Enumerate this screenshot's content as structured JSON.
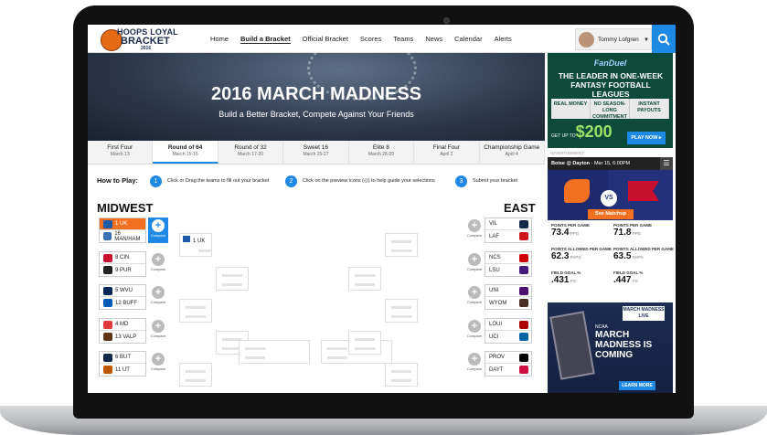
{
  "nav": {
    "logo": {
      "line1": "HOOPS LOYAL",
      "line2": "BRACKET",
      "line3": "2016"
    },
    "links": [
      "Home",
      "Build a Bracket",
      "Official Bracket",
      "Scores",
      "Teams",
      "News",
      "Calendar",
      "Alerts"
    ],
    "active_link": "Build a Bracket",
    "user_name": "Tommy Lofgren"
  },
  "hero": {
    "title": "2016 MARCH MADNESS",
    "subtitle": "Build a Better Bracket, Compete Against Your Friends"
  },
  "rounds": [
    {
      "label": "First Four",
      "date": "March 13"
    },
    {
      "label": "Round of 64",
      "date": "March 15-16",
      "active": true
    },
    {
      "label": "Round of 32",
      "date": "March 17-20"
    },
    {
      "label": "Sweet 16",
      "date": "March 25-27"
    },
    {
      "label": "Elite 8",
      "date": "March 28-29"
    },
    {
      "label": "Final Four",
      "date": "April 2"
    },
    {
      "label": "Championship Game",
      "date": "April 4"
    }
  ],
  "howto": {
    "label": "How to Play:",
    "steps": [
      {
        "num": "1",
        "text": "Click or Drag the teams to fill out your bracket"
      },
      {
        "num": "2",
        "text": "Click on the preview icons (◎) to help guide your selections"
      },
      {
        "num": "3",
        "text": "Submit your bracket"
      }
    ]
  },
  "regions": {
    "left": "MIDWEST",
    "right": "EAST"
  },
  "compare_label": "Compare",
  "left_matchups": [
    {
      "a": "1  UK",
      "b": "16 MAN/HAM",
      "selected": true,
      "ca": "#1e5aa8",
      "cb": "#3b6fb6"
    },
    {
      "a": "8  CIN",
      "b": "9  PUR",
      "ca": "#c8102e",
      "cb": "#222222"
    },
    {
      "a": "5  WVU",
      "b": "12 BUFF",
      "ca": "#002855",
      "cb": "#005bbb"
    },
    {
      "a": "4  MD",
      "b": "13 VALP",
      "ca": "#e03a3e",
      "cb": "#613318"
    },
    {
      "a": "6  BUT",
      "b": "11 UT",
      "ca": "#13294b",
      "cb": "#bf5700"
    }
  ],
  "right_matchups": [
    {
      "a": "VIL",
      "b": "LAF",
      "ca": "#13294b",
      "cb": "#ce181e"
    },
    {
      "a": "NCS",
      "b": "LSU",
      "ca": "#cc0000",
      "cb": "#461d7c"
    },
    {
      "a": "UNI",
      "b": "WYOM",
      "ca": "#4b116f",
      "cb": "#492f24"
    },
    {
      "a": "LOUI",
      "b": "UCI",
      "ca": "#ad0000",
      "cb": "#0064a4"
    },
    {
      "a": "PROV",
      "b": "DAYT",
      "ca": "#000000",
      "cb": "#ce1141"
    }
  ],
  "r32_first": "1  UK",
  "sidebar": {
    "ad1": {
      "brand": "FanDuel",
      "headline": "THE LEADER IN ONE-WEEK FANTASY FOOTBALL LEAGUES",
      "features": [
        "REAL MONEY",
        "NO SEASON-LONG COMMITMENT",
        "INSTANT PAYOUTS"
      ],
      "promo_prefix": "GET UP TO",
      "promo_amount": "$200",
      "promo_suffix": "FREE ON YOUR FIRST DEPOSIT",
      "cta": "PLAY NOW ▸"
    },
    "ad_label": "ADVERTISEMENT",
    "game": {
      "title": "Boise @ Dayton",
      "when": "· Mar 15, 6:00PM"
    },
    "vs": "VS",
    "see_matchup": "See Matchup",
    "stats_left": [
      {
        "k": "POINTS PER GAME",
        "v": "73.4",
        "u": "PPG"
      },
      {
        "k": "POINTS ALLOWED PER GAME",
        "v": "62.3",
        "u": "PAPG"
      },
      {
        "k": "FIELD GOAL %",
        "v": ".431",
        "u": "FG"
      }
    ],
    "stats_right": [
      {
        "k": "POINTS PER GAME",
        "v": "71.8",
        "u": "PPG"
      },
      {
        "k": "POINTS ALLOWED PER GAME",
        "v": "63.5",
        "u": "PAPG"
      },
      {
        "k": "FIELD GOAL %",
        "v": ".447",
        "u": "FG"
      }
    ],
    "ad2": {
      "badge": "MARCH MADNESS LIVE",
      "sub": "NCAA",
      "title": "MARCH MADNESS IS COMING",
      "cta": "LEARN MORE"
    }
  }
}
